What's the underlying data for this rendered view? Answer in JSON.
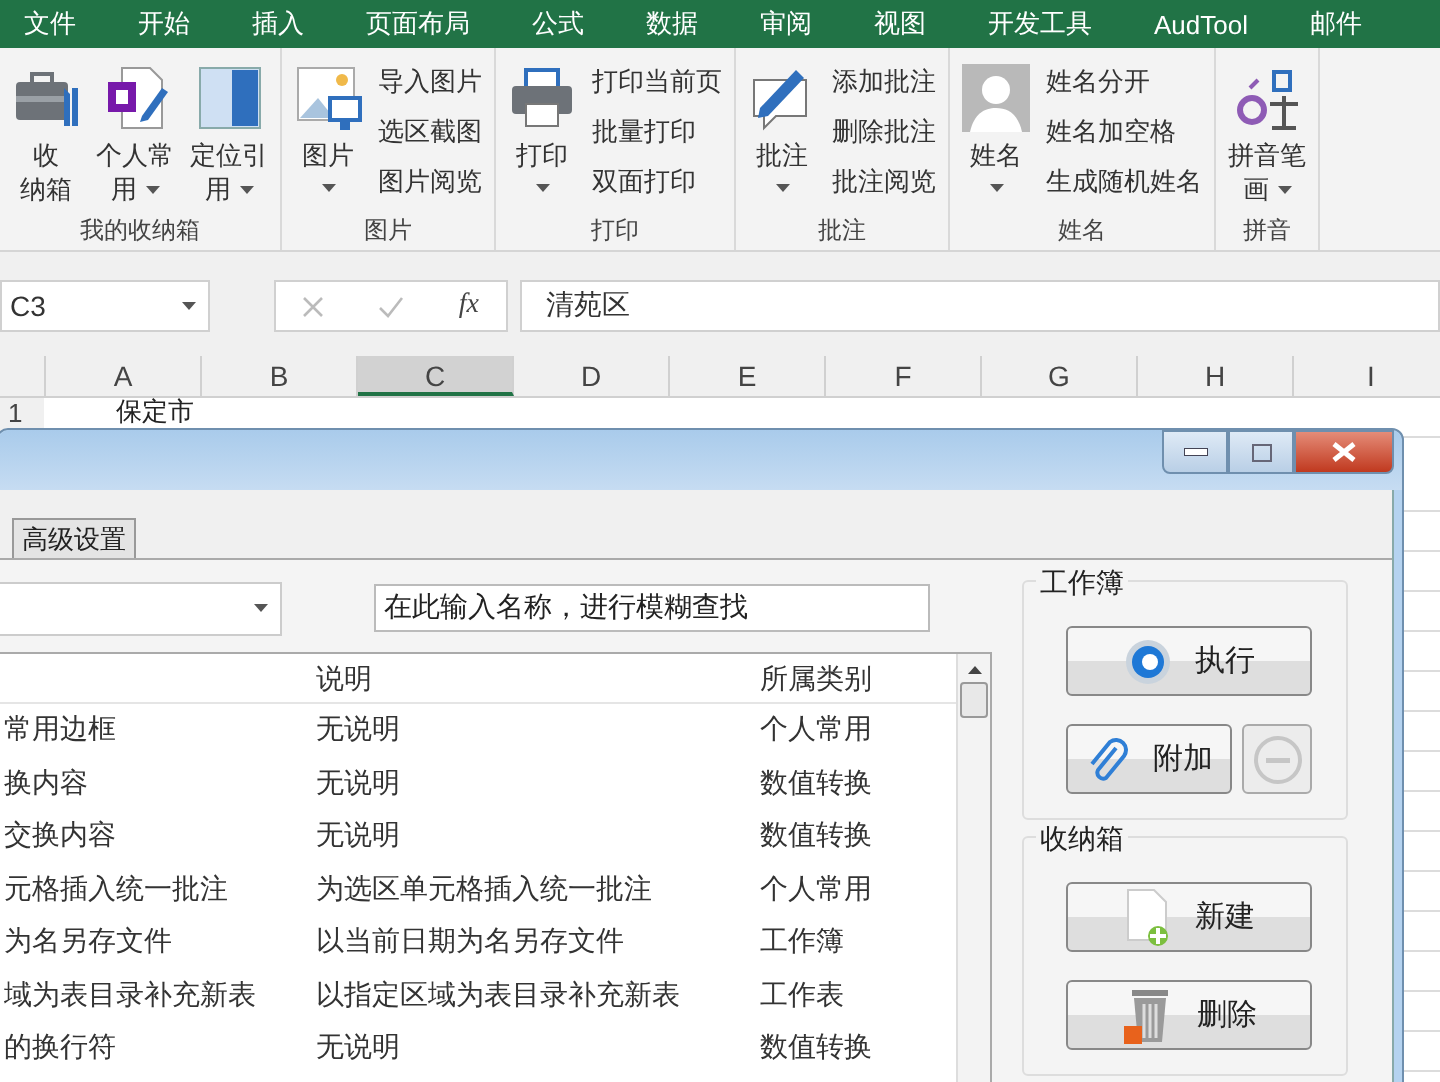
{
  "menu_tabs": [
    "文件",
    "开始",
    "插入",
    "页面布局",
    "公式",
    "数据",
    "审阅",
    "视图",
    "开发工具",
    "AudTool",
    "邮件"
  ],
  "ribbon_groups": [
    {
      "label": "我的收纳箱",
      "large_buttons": [
        {
          "kind": "toolbox",
          "lines": [
            "收",
            "纳箱"
          ],
          "dropdown": false
        },
        {
          "kind": "notebook",
          "lines": [
            "个人常",
            "用"
          ],
          "dropdown": true
        },
        {
          "kind": "panel",
          "lines": [
            "定位引",
            "用"
          ],
          "dropdown": true
        }
      ]
    },
    {
      "label": "图片",
      "large_buttons": [
        {
          "kind": "picture",
          "lines": [
            "图片"
          ],
          "dropdown": true
        }
      ],
      "small_buttons": [
        "导入图片",
        "选区截图",
        "图片阅览"
      ]
    },
    {
      "label": "打印",
      "large_buttons": [
        {
          "kind": "printer",
          "lines": [
            "打印"
          ],
          "dropdown": true
        }
      ],
      "small_buttons": [
        "打印当前页",
        "批量打印",
        "双面打印"
      ]
    },
    {
      "label": "批注",
      "large_buttons": [
        {
          "kind": "comment",
          "lines": [
            "批注"
          ],
          "dropdown": true
        }
      ],
      "small_buttons": [
        "添加批注",
        "删除批注",
        "批注阅览"
      ]
    },
    {
      "label": "姓名",
      "large_buttons": [
        {
          "kind": "person",
          "lines": [
            "姓名"
          ],
          "dropdown": true
        }
      ],
      "small_buttons": [
        "姓名分开",
        "姓名加空格",
        "生成随机姓名"
      ]
    },
    {
      "label": "拼音",
      "large_buttons": [
        {
          "kind": "pinyin",
          "lines": [
            "拼音笔",
            "画"
          ],
          "dropdown": true
        }
      ]
    }
  ],
  "formula_bar": {
    "name_box": "C3",
    "function_label": "fx",
    "content": "清苑区"
  },
  "sheet": {
    "columns": [
      {
        "label": "A",
        "selected": false
      },
      {
        "label": "B",
        "selected": false
      },
      {
        "label": "C",
        "selected": true
      },
      {
        "label": "D",
        "selected": false
      },
      {
        "label": "E",
        "selected": false
      },
      {
        "label": "F",
        "selected": false
      },
      {
        "label": "G",
        "selected": false
      },
      {
        "label": "H",
        "selected": false
      },
      {
        "label": "I",
        "selected": false
      }
    ],
    "rows": [
      {
        "header": "1",
        "cells": [
          "保定市"
        ]
      }
    ]
  },
  "dialog": {
    "tabs": [
      {
        "label": "高级设置",
        "selected": false
      }
    ],
    "search": {
      "value": "在此输入名称，进行模糊查找"
    },
    "list": {
      "columns": [
        "说明",
        "所属类别"
      ],
      "rows": [
        {
          "column_1": "常用边框",
          "description": "无说明",
          "category": "个人常用"
        },
        {
          "column_1": "换内容",
          "description": "无说明",
          "category": "数值转换"
        },
        {
          "column_1": "交换内容",
          "description": "无说明",
          "category": "数值转换"
        },
        {
          "column_1": "元格插入统一批注",
          "description": "为选区单元格插入统一批注",
          "category": "个人常用"
        },
        {
          "column_1": "为名另存文件",
          "description": "以当前日期为名另存文件",
          "category": "工作簿"
        },
        {
          "column_1": "域为表目录补充新表",
          "description": "以指定区域为表目录补充新表",
          "category": "工作表"
        },
        {
          "column_1": "的换行符",
          "description": "无说明",
          "category": "数值转换"
        }
      ]
    },
    "panels": [
      {
        "title": "工作簿",
        "buttons": [
          {
            "kind": "run",
            "label": "执行",
            "disabled": false
          },
          {
            "kind": "attach",
            "label": "附加",
            "disabled": false
          },
          {
            "kind": "remove",
            "disabled": true
          }
        ]
      },
      {
        "title": "收纳箱",
        "buttons": [
          {
            "kind": "new",
            "label": "新建",
            "disabled": false
          },
          {
            "kind": "delete",
            "label": "删除",
            "disabled": false
          }
        ]
      }
    ]
  }
}
